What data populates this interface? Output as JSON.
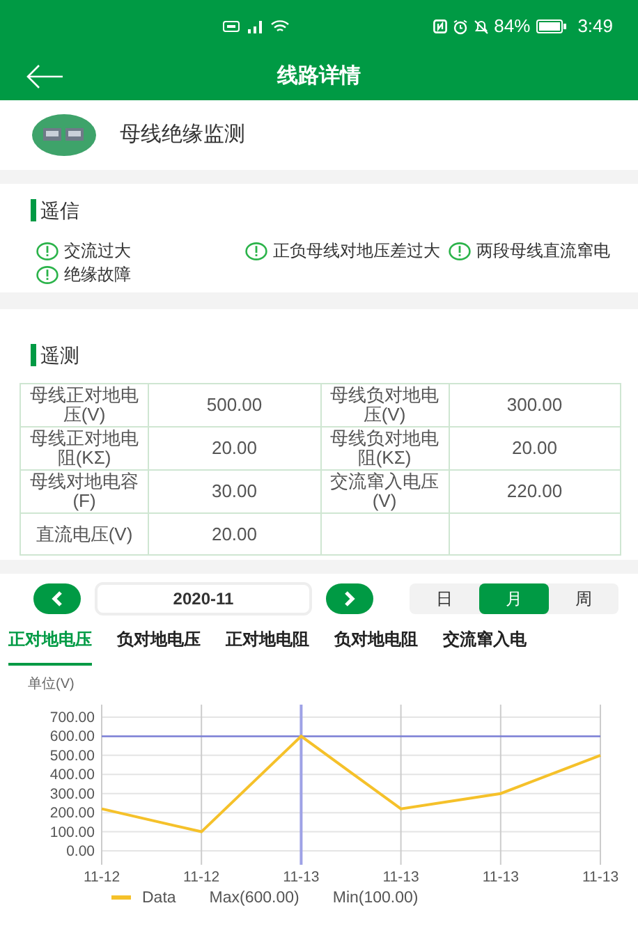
{
  "status_bar": {
    "battery": "84%",
    "time": "3:49"
  },
  "app_bar": {
    "title": "线路详情"
  },
  "device": {
    "name": "母线绝缘监测"
  },
  "remote_signal": {
    "title": "遥信",
    "alarms": [
      {
        "label": "交流过大"
      },
      {
        "label": "正负母线对地压差过大"
      },
      {
        "label": "两段母线直流窜电"
      },
      {
        "label": "绝缘故障"
      }
    ]
  },
  "remote_measure": {
    "title": "遥测",
    "rows": [
      {
        "items": [
          {
            "label": "母线正对地电压(V)",
            "value": "500.00"
          },
          {
            "label": "母线负对地电压(V)",
            "value": "300.00"
          }
        ]
      },
      {
        "items": [
          {
            "label": "母线正对地电阻(KΣ)",
            "value": "20.00"
          },
          {
            "label": "母线负对地电阻(KΣ)",
            "value": "20.00"
          }
        ]
      },
      {
        "items": [
          {
            "label": "母线对地电容(F)",
            "value": "30.00"
          },
          {
            "label": "交流窜入电压(V)",
            "value": "220.00"
          }
        ]
      },
      {
        "items": [
          {
            "label": "直流电压(V)",
            "value": "20.00"
          }
        ]
      }
    ]
  },
  "date_picker": {
    "value": "2020-11",
    "periods": [
      {
        "label": "日",
        "selected": false
      },
      {
        "label": "月",
        "selected": true
      },
      {
        "label": "周",
        "selected": false
      }
    ]
  },
  "tabs": [
    {
      "label": "正对地电压",
      "selected": true
    },
    {
      "label": "负对地电压",
      "selected": false
    },
    {
      "label": "正对地电阻",
      "selected": false
    },
    {
      "label": "负对地电阻",
      "selected": false
    },
    {
      "label": "交流窜入电",
      "selected": false
    }
  ],
  "unit": "单位(V)",
  "chart": {
    "chart_data": {
      "type": "line",
      "categories": [
        "11-12",
        "11-12",
        "11-13",
        "11-13",
        "11-13",
        "11-13"
      ],
      "series": [
        {
          "name": "Data",
          "color": "#f5c12a",
          "values": [
            220,
            100,
            600,
            220,
            300,
            500
          ]
        }
      ],
      "ylim": [
        0,
        700
      ],
      "yticks": [
        {
          "value": 0,
          "label": "0.00"
        },
        {
          "value": 100,
          "label": "100.00"
        },
        {
          "value": 200,
          "label": "200.00"
        },
        {
          "value": 300,
          "label": "300.00"
        },
        {
          "value": 400,
          "label": "400.00"
        },
        {
          "value": 500,
          "label": "500.00"
        },
        {
          "value": 600,
          "label": "600.00"
        },
        {
          "value": 700,
          "label": "700.00"
        }
      ],
      "grid": true,
      "ref_lines": [
        {
          "axis": "y",
          "value": 600,
          "color": "#7b7fd6"
        },
        {
          "axis": "x",
          "value": "11-13",
          "color": "#9ea2e6"
        }
      ]
    },
    "legend_notes": [
      "Max(600.00)",
      "Min(100.00)"
    ]
  }
}
